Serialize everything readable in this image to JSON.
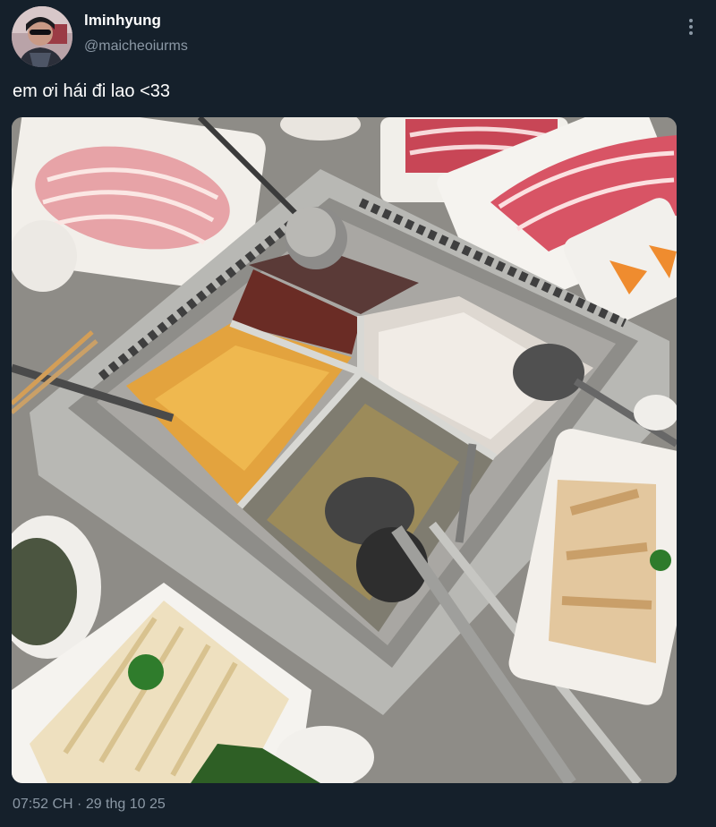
{
  "tweet": {
    "display_name": "lminhyung",
    "handle": "@maicheoiurms",
    "text": "em ơi hái đi lao <33",
    "timestamp": "07:52 CH · 29 thg 10 25",
    "avatar_icon": "profile-avatar",
    "more_icon": "more-vertical-icon"
  },
  "colors": {
    "background": "#15202b",
    "primary_text": "#ffffff",
    "secondary_text": "#8b98a5"
  }
}
